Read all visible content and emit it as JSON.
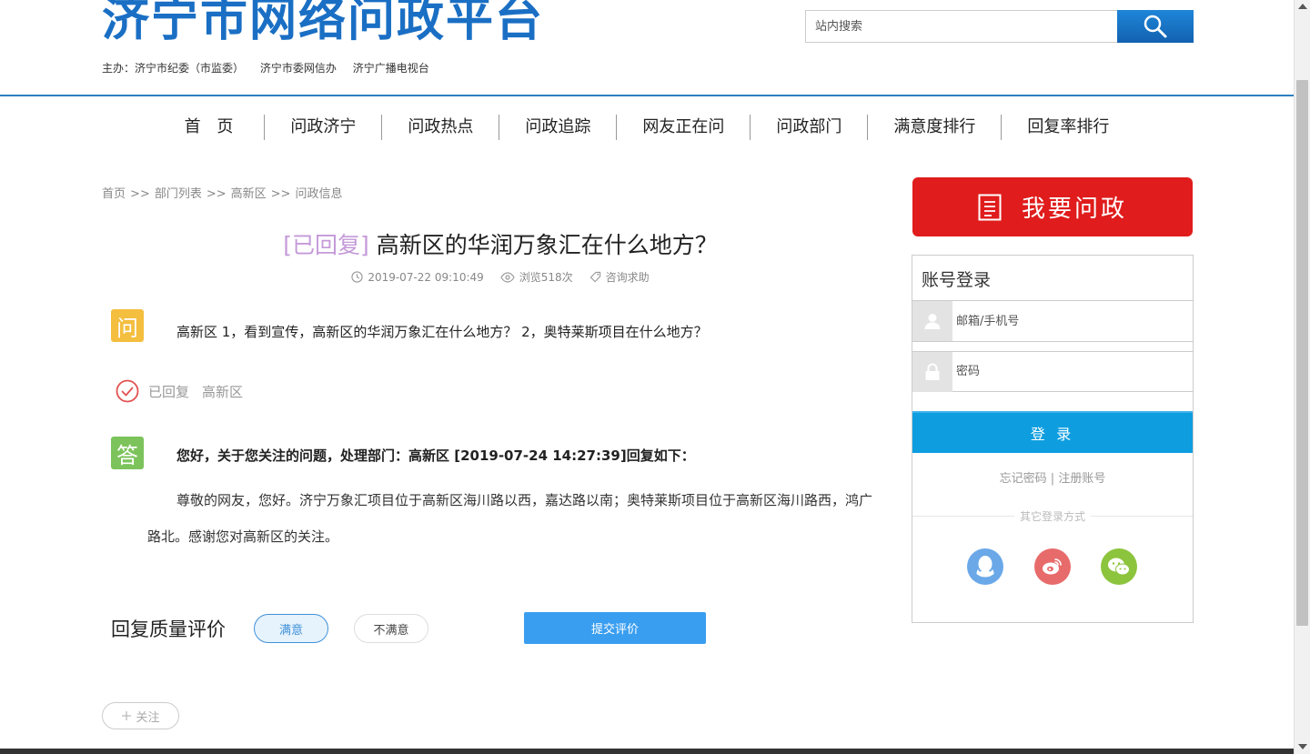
{
  "header": {
    "logo_text": "济宁市网络问政平台",
    "sponsors": [
      "主办：济宁市纪委（市监委）",
      "济宁市委网信办",
      "济宁广播电视台"
    ],
    "search_placeholder": "站内搜索",
    "search_icon": "search-icon"
  },
  "nav": {
    "items": [
      "首 页",
      "问政济宁",
      "问政热点",
      "问政追踪",
      "网友正在问",
      "问政部门",
      "满意度排行",
      "回复率排行"
    ]
  },
  "breadcrumb": [
    "首页",
    "部门列表",
    "高新区",
    "问政信息"
  ],
  "breadcrumb_sep": ">>",
  "post": {
    "status": "[已回复]",
    "title": " 高新区的华润万象汇在什么地方？",
    "time": "2019-07-22 09:10:49",
    "views": "浏览518次",
    "category": "咨询求助",
    "question_icon_label": "问",
    "question": "高新区 1，看到宣传，高新区的华润万象汇在什么地方？ 2，奥特莱斯项目在什么地方？",
    "reply_status": "已回复",
    "reply_dept": "高新区",
    "answer_icon_label": "答",
    "answer_head": "您好，关于您关注的问题，处理部门：高新区 [2019-07-24 14:27:39]回复如下：",
    "answer_body": "尊敬的网友，您好。济宁万象汇项目位于高新区海川路以西，嘉达路以南；奥特莱斯项目位于高新区海川路西，鸿广路北。感谢您对高新区的关注。"
  },
  "rating": {
    "label": "回复质量评价",
    "good": "满意",
    "bad": "不满意",
    "submit": "提交评价"
  },
  "follow": "关注",
  "sidebar": {
    "ask_label": "我要问政",
    "login_title": "账号登录",
    "user_placeholder": "邮箱/手机号",
    "pass_placeholder": "密码",
    "login_btn": "登 录",
    "forgot": "忘记密码",
    "register": "注册账号",
    "links_sep": " | ",
    "other_login": "其它登录方式"
  },
  "colors": {
    "brand_blue": "#1a6fc4",
    "ask_red": "#e01c1c",
    "login_blue": "#0e9ee0",
    "status_purple": "#c49ad9"
  }
}
